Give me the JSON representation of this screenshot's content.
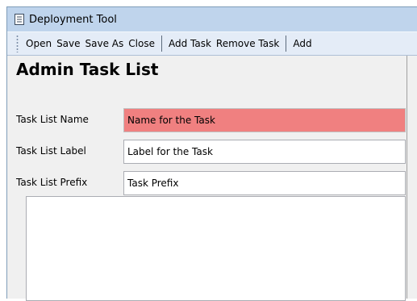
{
  "window": {
    "title": "Deployment Tool",
    "title_icon": "document-icon"
  },
  "toolbar": {
    "items": [
      {
        "label": "Open"
      },
      {
        "label": "Save"
      },
      {
        "label": "Save As"
      },
      {
        "label": "Close"
      },
      {
        "label": "Add Task"
      },
      {
        "label": "Remove Task"
      },
      {
        "label": "Add"
      }
    ]
  },
  "main": {
    "heading": "Admin Task List",
    "fields": {
      "name": {
        "label": "Task List Name",
        "value": "Name for the Task"
      },
      "label": {
        "label": "Task List Label",
        "value": "Label for the Task"
      },
      "prefix": {
        "label": "Task List Prefix",
        "value": "Task Prefix"
      }
    },
    "description": ""
  },
  "colors": {
    "title_bar": "#bfd4ec",
    "toolbar": "#e4ecf7",
    "panel": "#f0f0f0",
    "error_field": "#f08080"
  }
}
